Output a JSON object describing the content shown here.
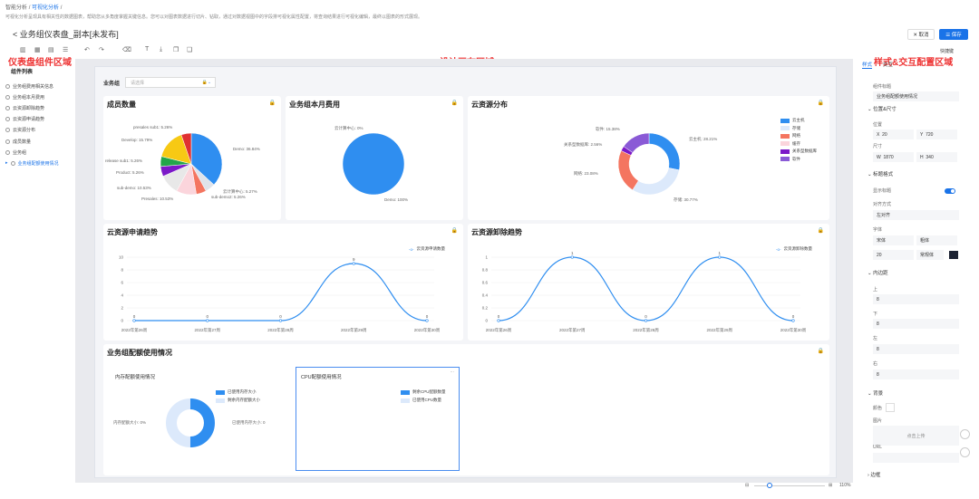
{
  "breadcrumb": {
    "root": "智能分析",
    "sep": "/",
    "current": "可视化分析",
    "end": "/"
  },
  "intro": "可视化分析呈现具有相关性的数据图表，帮助您从多角度掌握关键信息。您可以对图表数据进行切片、钻取，通过对数据视图中的字段排可视化属性配置，将查询结果进行可视化编辑，最终以图表的形式展现。",
  "page_title": "< 业务组仪表盘_副本[未发布]",
  "actions": {
    "cancel": "✕ 取消",
    "save": "☰ 保存"
  },
  "quick_link": "快捷键",
  "overlays": {
    "left": "仪表盘组件区域",
    "center": "设计画布区域",
    "right": "样式&交互配置区域"
  },
  "left_panel": {
    "title": "组件列表",
    "items": [
      {
        "label": "业务组费用相关信息",
        "selected": false
      },
      {
        "label": "业务组本月费用",
        "selected": false
      },
      {
        "label": "云资源卸除趋势",
        "selected": false
      },
      {
        "label": "云资源申请趋势",
        "selected": false
      },
      {
        "label": "云资源分布",
        "selected": false
      },
      {
        "label": "成员数量",
        "selected": false
      },
      {
        "label": "业务组",
        "selected": false
      },
      {
        "label": "业务组配额使用情况",
        "selected": true
      }
    ]
  },
  "filter": {
    "label": "业务组",
    "placeholder": "请选择"
  },
  "cards": {
    "members": {
      "title": "成员数量",
      "labels": [
        "presales sub1: 5.26%",
        "Develop: 15.79%",
        "release sub1: 5.26%",
        "Product: 5.26%",
        "sub-demo: 10.53%",
        "Presales: 10.53%",
        "Demo: 36.84%",
        "云计算中心: 5.27%",
        "sub-demo2: 5.26%"
      ]
    },
    "monthly": {
      "title": "业务组本月费用",
      "labels": [
        "云计算中心: 0%",
        "Demo: 100%"
      ]
    },
    "dist": {
      "title": "云资源分布",
      "labels": [
        "软件: 15.38%",
        "关系型数据库: 2.56%",
        "网络: 23.08%",
        "云主机: 28.21%",
        "存储: 30.77%"
      ],
      "legend": [
        "云主机",
        "存储",
        "网络",
        "缓存",
        "关系型数据库",
        "软件"
      ]
    },
    "apply": {
      "title": "云资源申请趋势",
      "legend": "云资源申请数量"
    },
    "remove": {
      "title": "云资源卸除趋势",
      "legend": "云资源卸除数量"
    },
    "quota": {
      "title": "业务组配额使用情况",
      "mem_title": "内存配额使用情况",
      "mem_legend": [
        "已使用内存大小",
        "剩余内存配额大小"
      ],
      "mem_labels": [
        "内存配额大小: 0%",
        "已使用内存大小: 0"
      ],
      "cpu_title": "CPU配额使用情况",
      "cpu_legend": [
        "剩余CPU配额数量",
        "已使用CPU数量"
      ]
    }
  },
  "chart_data": [
    {
      "type": "pie",
      "title": "成员数量",
      "categories": [
        "Demo",
        "云计算中心",
        "sub-demo2",
        "Presales",
        "sub-demo",
        "Product",
        "release sub1",
        "Develop",
        "presales sub1"
      ],
      "values": [
        36.84,
        5.27,
        5.26,
        10.53,
        10.53,
        5.26,
        5.26,
        15.79,
        5.26
      ],
      "colors": [
        "#2f8ef0",
        "#dfe3ea",
        "#f47560",
        "#fbd5dc",
        "#e8e8e8",
        "#7c19c8",
        "#23a64a",
        "#f7c914",
        "#e03131"
      ]
    },
    {
      "type": "pie",
      "title": "业务组本月费用",
      "categories": [
        "Demo",
        "云计算中心"
      ],
      "values": [
        100,
        0
      ]
    },
    {
      "type": "pie",
      "title": "云资源分布",
      "categories": [
        "云主机",
        "存储",
        "网络",
        "关系型数据库",
        "软件"
      ],
      "values": [
        28.21,
        30.77,
        23.08,
        2.56,
        15.38
      ],
      "colors": [
        "#2f8ef0",
        "#dce9fb",
        "#f47560",
        "#7c19c8",
        "#8a5ad6"
      ]
    },
    {
      "type": "line",
      "title": "云资源申请趋势",
      "x": [
        "2022年第26周",
        "2022年第27周",
        "2022年第28周",
        "2022年第29周",
        "2022年第30周"
      ],
      "series": [
        {
          "name": "云资源申请数量",
          "values": [
            0,
            0,
            0,
            9,
            0
          ]
        }
      ],
      "ylim": [
        0,
        10
      ]
    },
    {
      "type": "line",
      "title": "云资源卸除趋势",
      "x": [
        "2022年第26周",
        "2022年第27周",
        "2022年第28周",
        "2022年第29周",
        "2022年第30周"
      ],
      "series": [
        {
          "name": "云资源卸除数量",
          "values": [
            0,
            1,
            0,
            1,
            0
          ]
        }
      ],
      "ylim": [
        0,
        1
      ]
    }
  ],
  "right_panel": {
    "tabs": [
      "样式",
      "交互"
    ],
    "comp_title_label": "组件标题",
    "comp_title": "业务组配额使用情况",
    "pos_size": "位置&尺寸",
    "pos": "位置",
    "x_label": "X",
    "x": "20",
    "y_label": "Y",
    "y": "720",
    "size": "尺寸",
    "w_label": "W",
    "w": "1870",
    "h_label": "H",
    "h": "340",
    "title_style": "标题格式",
    "show_title": "显示标题",
    "align_label": "对齐方式",
    "align": "左对齐",
    "font_label": "字体",
    "font": "宋体",
    "weight": "粗体",
    "fsize": "20",
    "line": "常规体",
    "padding": "内边距",
    "top": "上",
    "top_v": "8",
    "bottom": "下",
    "bottom_v": "8",
    "left": "左",
    "left_v": "8",
    "right": "右",
    "right_v": "8",
    "bg": "背景",
    "color_label": "颜色",
    "image": "图片",
    "upload": "点击上传",
    "url": "URL",
    "border": "边框"
  },
  "zoom": "110%"
}
